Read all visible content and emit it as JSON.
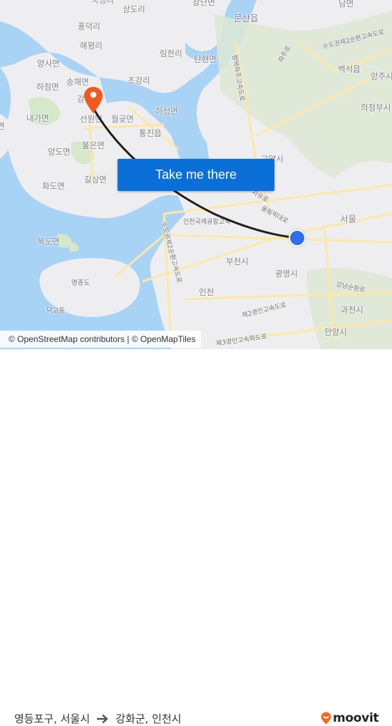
{
  "map": {
    "labels": [
      {
        "text": "국성리",
        "cls": "lbl"
      },
      {
        "text": "상도리",
        "cls": "lbl"
      },
      {
        "text": "장단면",
        "cls": "lbl"
      },
      {
        "text": "문산읍",
        "cls": "lbl big"
      },
      {
        "text": "남면",
        "cls": "lbl"
      },
      {
        "text": "풍덕리",
        "cls": "lbl"
      },
      {
        "text": "해평리",
        "cls": "lbl"
      },
      {
        "text": "림한리",
        "cls": "lbl"
      },
      {
        "text": "탄현면",
        "cls": "lbl"
      },
      {
        "text": "양사면",
        "cls": "lbl"
      },
      {
        "text": "송해면",
        "cls": "lbl"
      },
      {
        "text": "하점면",
        "cls": "lbl"
      },
      {
        "text": "조강리",
        "cls": "lbl"
      },
      {
        "text": "백석읍",
        "cls": "lbl"
      },
      {
        "text": "양주시",
        "cls": "lbl"
      },
      {
        "text": "의정부시",
        "cls": "lbl"
      },
      {
        "text": "강",
        "cls": "lbl"
      },
      {
        "text": "내가면",
        "cls": "lbl"
      },
      {
        "text": "선원면",
        "cls": "lbl"
      },
      {
        "text": "월곶면",
        "cls": "lbl"
      },
      {
        "text": "하성면",
        "cls": "lbl"
      },
      {
        "text": "통진읍",
        "cls": "lbl"
      },
      {
        "text": "불은면",
        "cls": "lbl"
      },
      {
        "text": "양도면",
        "cls": "lbl"
      },
      {
        "text": "길상면",
        "cls": "lbl"
      },
      {
        "text": "화도면",
        "cls": "lbl"
      },
      {
        "text": "고양시",
        "cls": "lbl"
      },
      {
        "text": "서울",
        "cls": "lbl big"
      },
      {
        "text": "북도면",
        "cls": "lbl"
      },
      {
        "text": "인천국제공항고속",
        "cls": "lbl road"
      },
      {
        "text": "부천시",
        "cls": "lbl"
      },
      {
        "text": "광명시",
        "cls": "lbl"
      },
      {
        "text": "영종도",
        "cls": "lbl small"
      },
      {
        "text": "덕교동",
        "cls": "lbl small"
      },
      {
        "text": "인천",
        "cls": "lbl"
      },
      {
        "text": "과천시",
        "cls": "lbl"
      },
      {
        "text": "안양시",
        "cls": "lbl"
      },
      {
        "text": "강남순환로",
        "cls": "lbl road"
      },
      {
        "text": "제2경인고속도로",
        "cls": "lbl road"
      },
      {
        "text": "제3경인고속화도로",
        "cls": "lbl road"
      },
      {
        "text": "올림픽대로",
        "cls": "lbl road"
      },
      {
        "text": "자유로",
        "cls": "lbl road"
      },
      {
        "text": "수도권제2순환고속도로",
        "cls": "lbl road"
      },
      {
        "text": "평택파주고속도로",
        "cls": "lbl road"
      },
      {
        "text": "파주로",
        "cls": "lbl road"
      },
      {
        "text": "수도권제2순환고속도로",
        "cls": "lbl road"
      },
      {
        "text": "면",
        "cls": "lbl"
      }
    ],
    "origin_marker": "blue-dot",
    "destination_marker": "orange-pin",
    "colors": {
      "water": "#a9d3f5",
      "land": "#eeeef0",
      "park": "#d5e8c9",
      "road": "#fbe8a6",
      "route_line": "#1f1f1f",
      "pin": "#f2581f",
      "dot": "#2f6fe8"
    }
  },
  "cta": {
    "label": "Take me there",
    "color": "#0a6fd6"
  },
  "attribution": "© OpenStreetMap contributors | © OpenMapTiles",
  "footer": {
    "from": "영등포구, 서울시",
    "arrow_icon": "right-arrow-icon",
    "to": "강화군, 인천시",
    "brand": "moovit",
    "brand_color": "#f26b21"
  }
}
